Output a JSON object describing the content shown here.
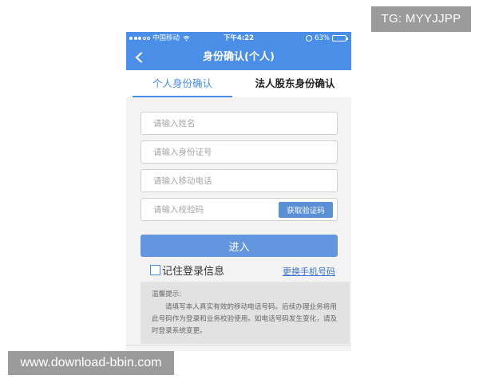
{
  "overlays": {
    "top_label": "TG: MYYJJPP",
    "bottom_label": "www.download-bbin.com"
  },
  "statusbar": {
    "carrier": "中国移动",
    "time": "下午4:22",
    "battery": "63%",
    "battery_level": 0.63
  },
  "navbar": {
    "title": "身份确认(个人)"
  },
  "tabs": [
    {
      "label": "个人身份确认",
      "active": true
    },
    {
      "label": "法人股东身份确认",
      "active": false
    }
  ],
  "form": {
    "name_placeholder": "请输入姓名",
    "id_placeholder": "请输入身份证号",
    "phone_placeholder": "请输入移动电话",
    "code_placeholder": "请输入校验码",
    "get_code_label": "获取验证码"
  },
  "actions": {
    "login_label": "进入",
    "remember_label": "记住登录信息",
    "remember_checked": false,
    "change_phone_label": "更换手机号码"
  },
  "tips": {
    "title": "温馨提示:",
    "body": "请填写本人真实有效的移动电话号码。后续办理业务将用此号码作为登录和业务校验使用。如电话号码发生变化，请及时登录系统变更。"
  },
  "colors": {
    "primary": "#4a8ee8",
    "button": "#6496e0",
    "link": "#3a73c9",
    "battery_fill": "#f5c342"
  }
}
